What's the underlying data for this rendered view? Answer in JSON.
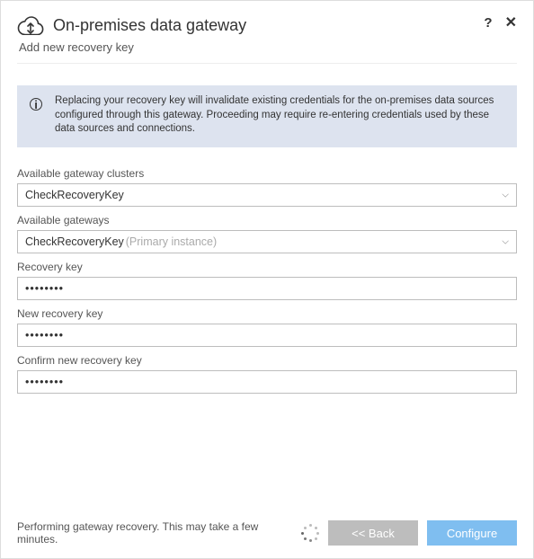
{
  "header": {
    "title": "On-premises data gateway",
    "subtitle": "Add new recovery key"
  },
  "banner": {
    "text": "Replacing your recovery key will invalidate existing credentials for the on-premises data sources configured through this gateway. Proceeding may require re-entering credentials used by these data sources and connections."
  },
  "fields": {
    "clusters_label": "Available gateway clusters",
    "clusters_value": "CheckRecoveryKey",
    "gateways_label": "Available gateways",
    "gateways_value": "CheckRecoveryKey",
    "gateways_hint": "(Primary instance)",
    "recovery_label": "Recovery key",
    "recovery_value": "••••••••",
    "new_recovery_label": "New recovery key",
    "new_recovery_value": "••••••••",
    "confirm_label": "Confirm new recovery key",
    "confirm_value": "••••••••"
  },
  "footer": {
    "status": "Performing gateway recovery. This may take a few minutes.",
    "back_label": "<< Back",
    "configure_label": "Configure"
  }
}
